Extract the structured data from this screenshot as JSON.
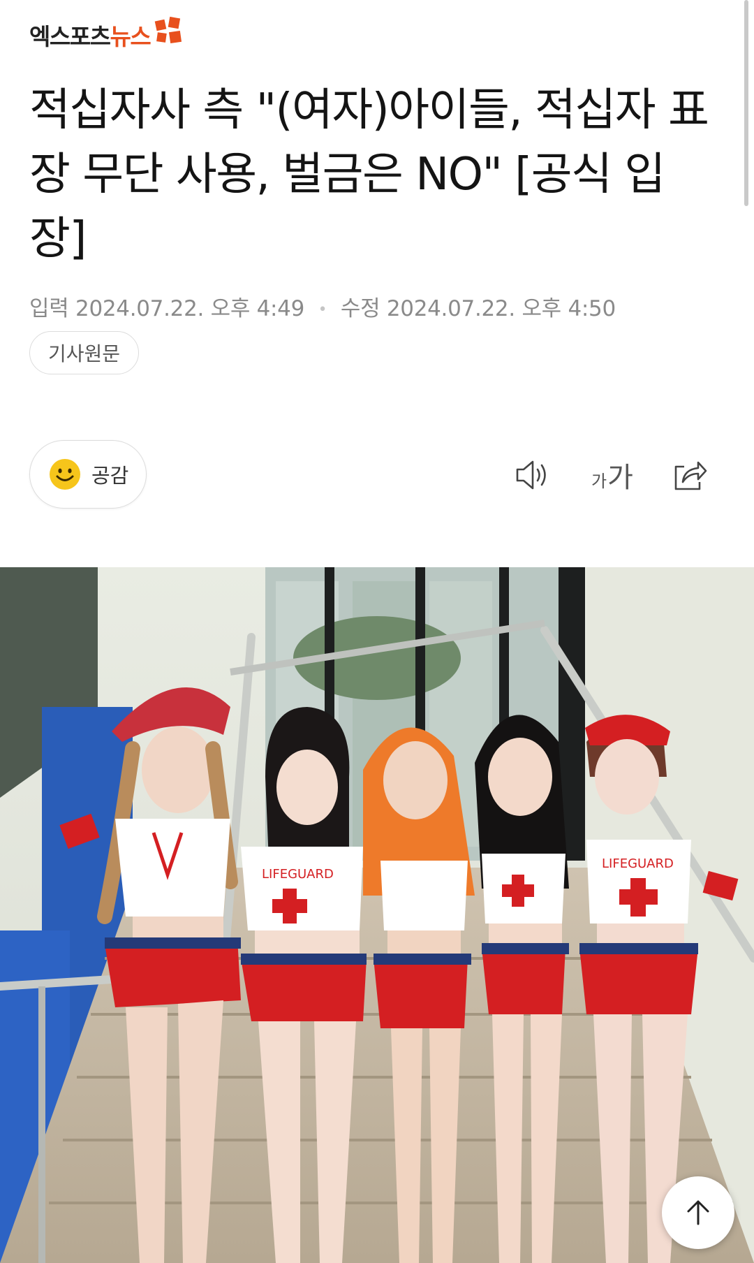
{
  "header": {
    "logo_text_main": "엑스포츠",
    "logo_text_accent": "뉴스"
  },
  "article": {
    "title": "적십자사 측 \"(여자)아이들, 적십자 표장 무단 사용, 벌금은 NO\" [공식 입장]",
    "input_label": "입력",
    "input_datetime": "2024.07.22. 오후 4:49",
    "separator": "•",
    "modified_label": "수정",
    "modified_datetime": "2024.07.22. 오후 4:50",
    "original_button": "기사원문"
  },
  "toolbar": {
    "reaction_label": "공감",
    "font_small": "가",
    "font_large": "가",
    "icons": [
      "smile-icon",
      "speaker-icon",
      "font-size-icon",
      "share-icon",
      "arrow-up-icon"
    ]
  },
  "photo": {
    "shirt_text": "LIFEGUARD"
  },
  "colors": {
    "accent": "#e8501d",
    "text": "#141414",
    "muted": "#8a8a8a",
    "border": "#dcdcdc",
    "smile": "#f6c51b",
    "lifeguard_red": "#d41f22"
  }
}
